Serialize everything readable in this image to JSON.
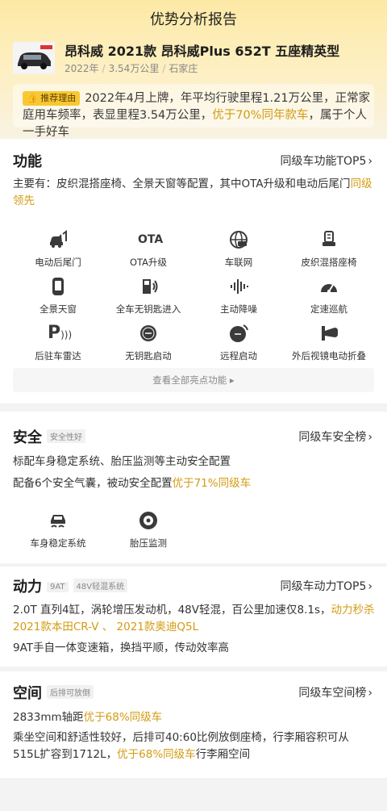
{
  "header": {
    "title": "优势分析报告"
  },
  "car": {
    "name": "昂科威 2021款 昂科威Plus 652T 五座精英型",
    "year": "2022年",
    "mileage": "3.54万公里",
    "city": "石家庄"
  },
  "recommend": {
    "badge": "推荐理由",
    "text_a": "2022年4月上牌，年平均行驶里程1.21万公里，正常家庭用车频率，表显里程3.54万公里，",
    "text_hl": "优于70%同年款车",
    "text_b": "，属于个人一手好车"
  },
  "function": {
    "title": "功能",
    "link": "同级车功能TOP5",
    "summary_a": "主要有：皮织混搭座椅、全景天窗等配置，其中OTA升级和电动后尾门",
    "summary_hl": "同级领先",
    "features": [
      {
        "icon": "tailgate-icon",
        "label": "电动后尾门"
      },
      {
        "icon": "ota-icon",
        "label": "OTA升级",
        "text": "OTA"
      },
      {
        "icon": "connected-car-icon",
        "label": "车联网"
      },
      {
        "icon": "leather-seat-icon",
        "label": "皮织混搭座椅"
      },
      {
        "icon": "panoramic-sunroof-icon",
        "label": "全景天窗"
      },
      {
        "icon": "keyless-entry-icon",
        "label": "全车无钥匙进入"
      },
      {
        "icon": "noise-cancel-icon",
        "label": "主动降噪"
      },
      {
        "icon": "cruise-icon",
        "label": "定速巡航"
      },
      {
        "icon": "parking-radar-icon",
        "label": "后驻车雷达",
        "text": "P"
      },
      {
        "icon": "keyless-start-icon",
        "label": "无钥匙启动"
      },
      {
        "icon": "remote-start-icon",
        "label": "远程启动"
      },
      {
        "icon": "mirror-fold-icon",
        "label": "外后视镜电动折叠"
      }
    ],
    "more": "查看全部亮点功能"
  },
  "safety": {
    "title": "安全",
    "tag": "安全性好",
    "link": "同级车安全榜",
    "line1": "标配车身稳定系统、胎压监测等主动安全配置",
    "line2_a": "配备6个安全气囊，被动安全配置",
    "line2_hl": "优于71%同级车",
    "features": [
      {
        "icon": "esp-icon",
        "label": "车身稳定系统"
      },
      {
        "icon": "tire-pressure-icon",
        "label": "胎压监测"
      }
    ]
  },
  "power": {
    "title": "动力",
    "tag1": "9AT",
    "tag2": "48V轻混系统",
    "link": "同级车动力TOP5",
    "line1_a": "2.0T 直列4缸，涡轮增压发动机，48V轻混，百公里加速仅8.1s，",
    "line1_hl": "动力秒杀2021款本田CR-V",
    "line1_sep": " 、 ",
    "line1_hl2": "2021款奥迪Q5L",
    "line2": "9AT手自一体变速箱，换挡平顺，传动效率高"
  },
  "space": {
    "title": "空间",
    "tag": "后排可放倒",
    "link": "同级车空间榜",
    "line1_a": "2833mm轴距",
    "line1_hl": "优于68%同级车",
    "line2_a": "乘坐空间和舒适性较好，后排可40:60比例放倒座椅，行李厢容积可从515L扩容到1712L，",
    "line2_hl": "优于68%同级车",
    "line2_b": "行李厢空间"
  }
}
